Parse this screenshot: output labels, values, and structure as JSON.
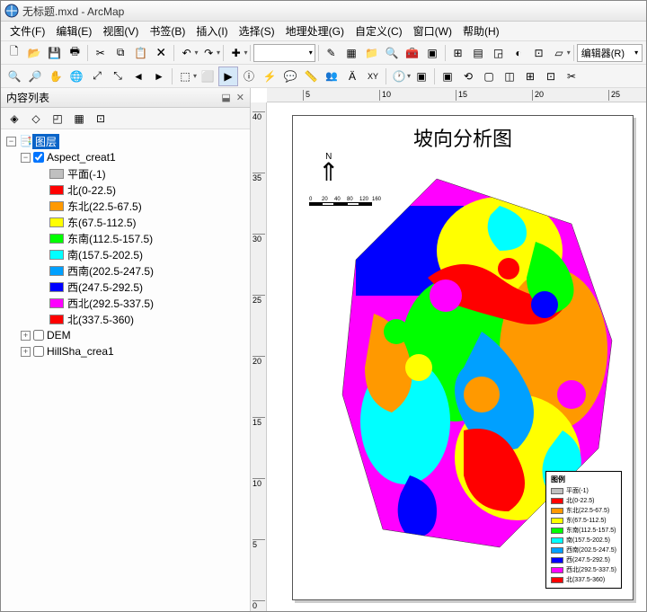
{
  "window": {
    "title": "无标题.mxd - ArcMap"
  },
  "menu": [
    {
      "label": "文件(F)"
    },
    {
      "label": "编辑(E)"
    },
    {
      "label": "视图(V)"
    },
    {
      "label": "书签(B)"
    },
    {
      "label": "插入(I)"
    },
    {
      "label": "选择(S)"
    },
    {
      "label": "地理处理(G)"
    },
    {
      "label": "自定义(C)"
    },
    {
      "label": "窗口(W)"
    },
    {
      "label": "帮助(H)"
    }
  ],
  "toolbar": {
    "scale": "",
    "editor": "编辑器(R)"
  },
  "toc": {
    "title": "内容列表",
    "root": "图层",
    "aspect_layer": "Aspect_creat1",
    "dem_layer": "DEM",
    "hillshade_layer": "HillSha_crea1",
    "classes": [
      {
        "color": "#c0c0c0",
        "label": "平面(-1)"
      },
      {
        "color": "#ff0000",
        "label": "北(0-22.5)"
      },
      {
        "color": "#ff9900",
        "label": "东北(22.5-67.5)"
      },
      {
        "color": "#ffff00",
        "label": "东(67.5-112.5)"
      },
      {
        "color": "#00ff00",
        "label": "东南(112.5-157.5)"
      },
      {
        "color": "#00ffff",
        "label": "南(157.5-202.5)"
      },
      {
        "color": "#00a0ff",
        "label": "西南(202.5-247.5)"
      },
      {
        "color": "#0000ff",
        "label": "西(247.5-292.5)"
      },
      {
        "color": "#ff00ff",
        "label": "西北(292.5-337.5)"
      },
      {
        "color": "#ff0000",
        "label": "北(337.5-360)"
      }
    ]
  },
  "map": {
    "title": "坡向分析图",
    "north_label": "N",
    "scale_ticks": [
      "0",
      "20",
      "40",
      "80",
      "120",
      "160"
    ],
    "legend_title": "图例",
    "legend_items": [
      {
        "color": "#c0c0c0",
        "label": "平面(-1)"
      },
      {
        "color": "#ff0000",
        "label": "北(0-22.5)"
      },
      {
        "color": "#ff9900",
        "label": "东北(22.5-67.5)"
      },
      {
        "color": "#ffff00",
        "label": "东(67.5-112.5)"
      },
      {
        "color": "#00ff00",
        "label": "东南(112.5-157.5)"
      },
      {
        "color": "#00ffff",
        "label": "南(157.5-202.5)"
      },
      {
        "color": "#00a0ff",
        "label": "西南(202.5-247.5)"
      },
      {
        "color": "#0000ff",
        "label": "西(247.5-292.5)"
      },
      {
        "color": "#ff00ff",
        "label": "西北(292.5-337.5)"
      },
      {
        "color": "#ff0000",
        "label": "北(337.5-360)"
      }
    ],
    "ruler_h": [
      "5",
      "10",
      "15",
      "20",
      "25"
    ],
    "ruler_v": [
      "40",
      "35",
      "30",
      "25",
      "20",
      "15",
      "10",
      "5",
      "0"
    ]
  }
}
